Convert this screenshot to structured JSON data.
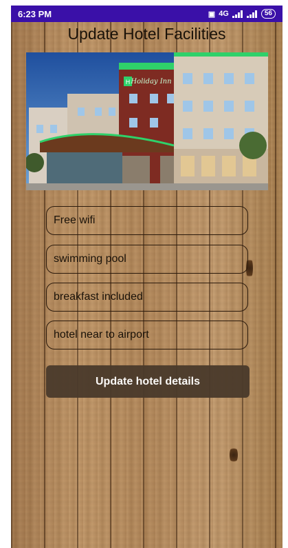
{
  "status_bar": {
    "time": "6:23 PM",
    "signal_label": "4G",
    "battery": "56"
  },
  "screen": {
    "title": "Update Hotel Facilities"
  },
  "hero": {
    "sign_text": "Holiday Inn",
    "logo_letter": "H"
  },
  "facilities": [
    {
      "value": "Free wifi"
    },
    {
      "value": "swimming pool"
    },
    {
      "value": "breakfast included"
    },
    {
      "value": "hotel near to airport"
    }
  ],
  "actions": {
    "update_label": "Update hotel details"
  },
  "colors": {
    "status_bar": "#3a10a8",
    "button": "#4a3a2b",
    "wood": "#b58a5c"
  }
}
